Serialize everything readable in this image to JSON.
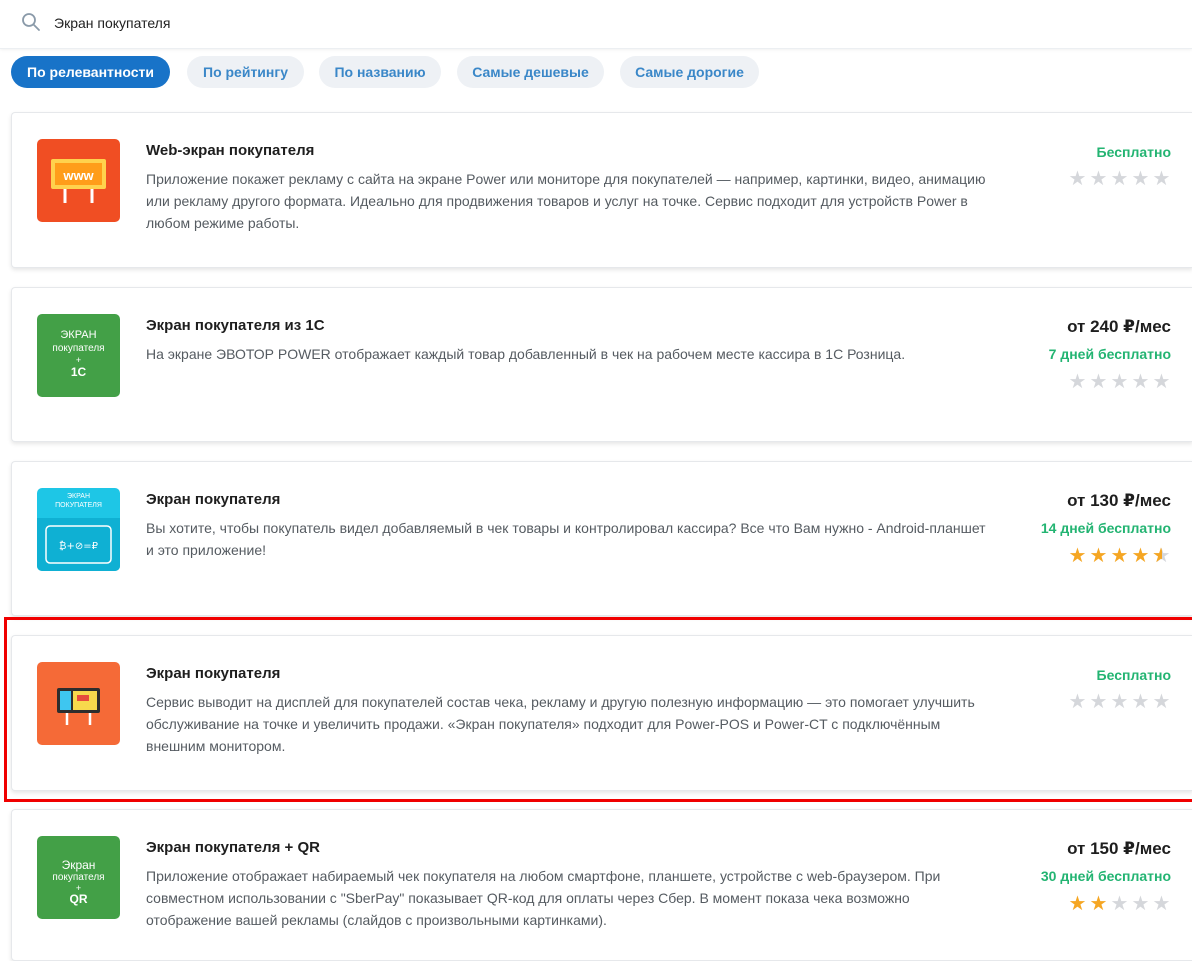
{
  "search": {
    "value": "Экран покупателя",
    "icon": "search-icon"
  },
  "sort_tabs": [
    {
      "label": "По релевантности",
      "active": true
    },
    {
      "label": "По рейтингу",
      "active": false
    },
    {
      "label": "По названию",
      "active": false
    },
    {
      "label": "Самые дешевые",
      "active": false
    },
    {
      "label": "Самые дорогие",
      "active": false
    }
  ],
  "colors": {
    "accent": "#1873c8",
    "free_green": "#23b472",
    "star_on": "#f5a623",
    "star_off": "#d5d7db",
    "highlight": "#f00000"
  },
  "apps": [
    {
      "title": "Web-экран покупателя",
      "description": "Приложение покажет рекламу с сайта на экране Power или мониторе для покупателей — например, картинки, видео, анимацию или рекламу другого формата. Идеально для продвижения товаров и услуг на точке. Сервис подходит для устройств Power в любом режиме работы.",
      "price": "Бесплатно",
      "trial": "",
      "rating": 0,
      "logo": {
        "icon": "www-billboard-icon",
        "bg": "#f04e23",
        "text": "www"
      }
    },
    {
      "title": "Экран покупателя из 1С",
      "description": "На экране ЭВОТОР POWER отображает каждый товар добавленный в чек на рабочем месте кассира в 1С Розница.",
      "price": "от 240 ₽/мес",
      "trial": "7 дней бесплатно",
      "rating": 0,
      "logo": {
        "icon": "screen-1c-logo-icon",
        "bg": "#43a047",
        "line1": "ЭКРАН",
        "line2": "покупателя",
        "line3": "+",
        "line4": "1С"
      }
    },
    {
      "title": "Экран покупателя",
      "description": "Вы хотите, чтобы покупатель видел добавляемый в чек товары и контролировал кассира? Все что Вам нужно - Android-планшет и это приложение!",
      "price": "от 130 ₽/мес",
      "trial": "14 дней бесплатно",
      "rating": 4.5,
      "logo": {
        "icon": "customer-screen-tablet-icon",
        "bg": "#1ec6e6",
        "line1": "ЭКРАН",
        "line2": "ПОКУПАТЕЛЯ"
      }
    },
    {
      "title": "Экран покупателя",
      "description": "Сервис выводит на дисплей для покупателей состав чека, рекламу и другую полезную информацию — это помогает улучшить обслуживание на точке и увеличить продажи. «Экран покупателя» подходит для Power-POS и Power-CT с подключённым внешним монитором.",
      "price": "Бесплатно",
      "trial": "",
      "rating": 0,
      "logo": {
        "icon": "display-billboard-icon",
        "bg": "#f56a37"
      }
    },
    {
      "title": "Экран покупателя + QR",
      "description": "Приложение отображает набираемый чек покупателя на любом смартфоне, планшете, устройстве с web-браузером. При совместном использовании с \"SberPay\" показывает QR-код для оплаты через Сбер. В момент показа чека возможно отображение вашей рекламы (слайдов с произвольными картинками).",
      "price": "от 150 ₽/мес",
      "trial": "30 дней бесплатно",
      "rating": 2,
      "logo": {
        "icon": "screen-qr-logo-icon",
        "bg": "#43a047",
        "line1": "Экран",
        "line2": "покупателя",
        "line3": "+",
        "line4": "QR"
      }
    }
  ]
}
